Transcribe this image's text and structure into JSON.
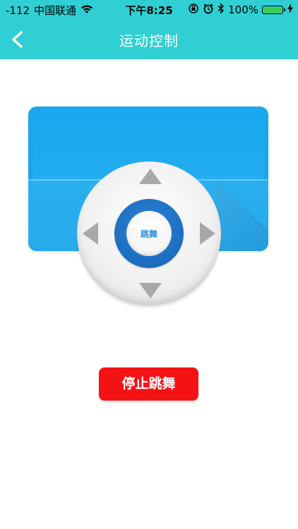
{
  "status_bar": {
    "signal": "-112",
    "carrier": "中国联通",
    "time": "下午8:25",
    "battery": "100%",
    "icons": [
      "wifi-icon",
      "orientation-lock-icon",
      "alarm-icon",
      "bluetooth-icon",
      "battery-icon",
      "charging-icon"
    ],
    "battery_level": 1.0
  },
  "nav": {
    "title": "运动控制",
    "back_icon": "chevron-left-icon"
  },
  "remote": {
    "center_label": "跳舞",
    "directions": [
      "up",
      "down",
      "left",
      "right"
    ]
  },
  "actions": {
    "stop_label": "停止跳舞"
  },
  "colors": {
    "accent": "#2fcfd3",
    "panel": "#1aa6ec",
    "dpad_center_ring": "#1e6fc3",
    "stop_button": "#f51215",
    "arrow": "#a8a8a8",
    "battery": "#35d24a"
  }
}
